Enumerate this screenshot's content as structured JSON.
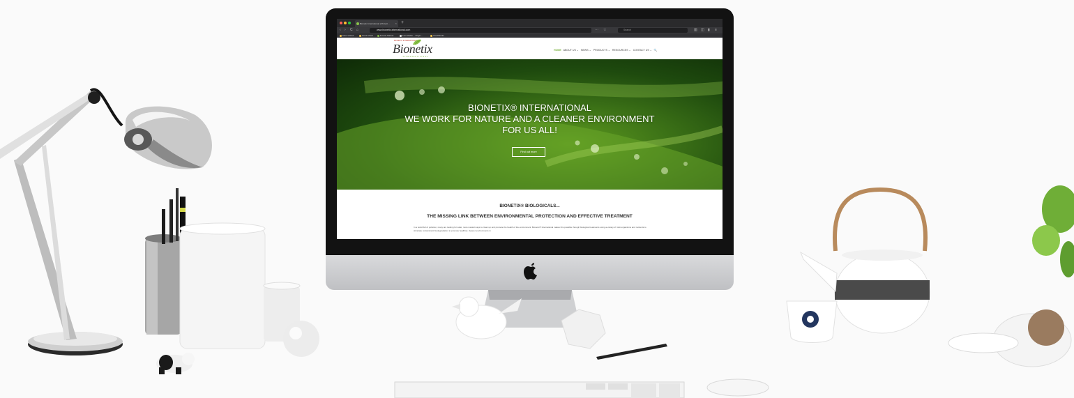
{
  "browser": {
    "tab_title": "Bionetix International | Protect ...",
    "tab_close": "×",
    "new_tab": "+",
    "url": "www.bionetix-international.com",
    "search_placeholder": "Search",
    "back": "‹",
    "forward": "›",
    "reload": "C",
    "home": "⌂",
    "bookmarks": [
      "Most Visited",
      "Stock Music",
      "Envato Market",
      "Formidable – Origin...",
      "IrisedWorks"
    ]
  },
  "site": {
    "logo_small": "BIONETIX INTERNATIONAL",
    "logo": "Bionetix",
    "logo_sub": "INTERNATIONAL",
    "nav": [
      "HOME",
      "ABOUT US ⌄",
      "NEWS ⌄",
      "PRODUCTS ⌄",
      "RESOURCES ⌄",
      "CONTACT US ⌄",
      "🔍"
    ],
    "hero_title": "BIONETIX® INTERNATIONAL",
    "hero_sub_1": "WE WORK FOR NATURE AND A CLEANER ENVIRONMENT",
    "hero_sub_2": "FOR US ALL!",
    "hero_button": "Find out more",
    "intro_heading_1": "BIONETIX® BIOLOGICALS...",
    "intro_heading_2": "THE MISSING LINK BETWEEN ENVIRONMENTAL PROTECTION AND EFFECTIVE TREATMENT",
    "intro_text": "In a world full of pollution, many are looking for safer, more natural ways to clean up and promote the health of the environment. Bionetix® International makes this possible through biological treatments using a variety of microorganisms and nutrients to stimulate contaminant biodegradation to promote healthier, cleaner environments in"
  },
  "colors": {
    "accent_green": "#7cb342",
    "logo_red": "#c0392b",
    "bezel": "#121212"
  }
}
